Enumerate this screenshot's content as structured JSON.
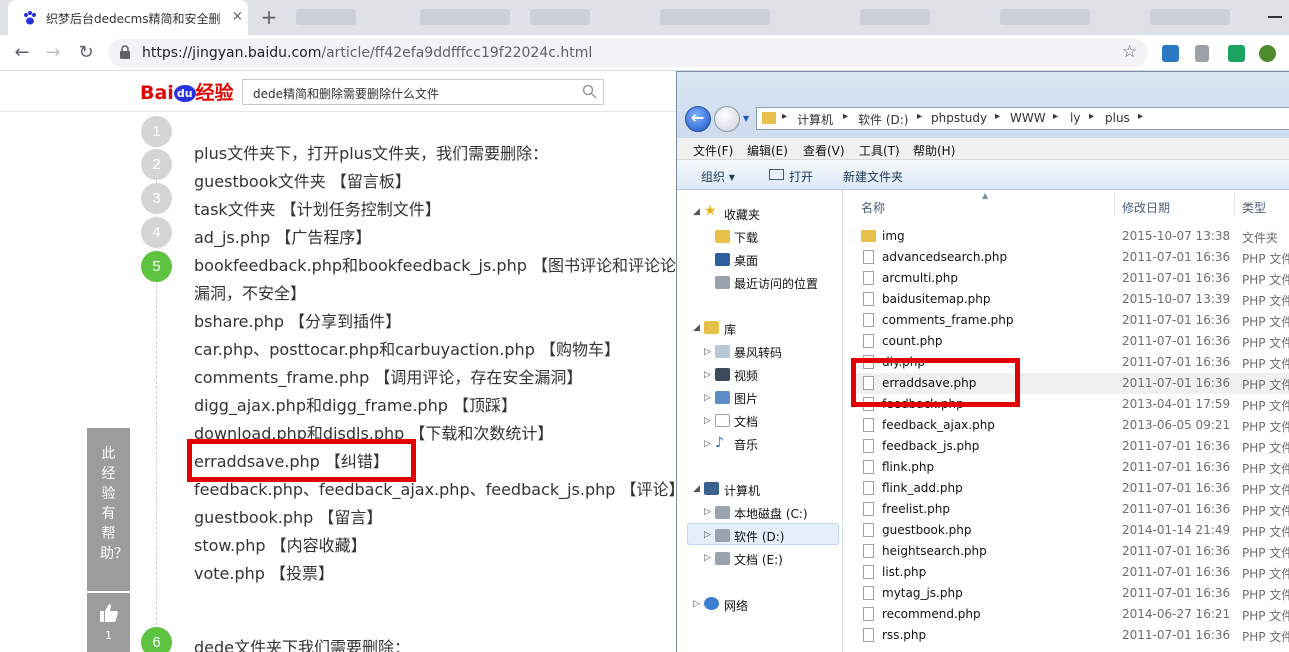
{
  "browser": {
    "tab_title": "织梦后台dedecms精简和安全删",
    "tab_close": "×",
    "new_tab": "+",
    "url_host": "https://jingyan.baidu.com",
    "url_path": "/article/ff42efa9ddfffcc19f22024c.html",
    "star": "☆"
  },
  "baidu": {
    "logo_bai": "Bai",
    "logo_du": "du",
    "logo_jy": "经验",
    "search_value": "dede精简和删除需要删除什么文件",
    "steps": [
      "1",
      "2",
      "3",
      "4",
      "5",
      "6"
    ],
    "lines": [
      "plus文件夹下，打开plus文件夹，我们需要删除：",
      "guestbook文件夹  【留言板】",
      "task文件夹        【计划任务控制文件】",
      "ad_js.php         【广告程序】",
      "bookfeedback.php和bookfeedback_js.php     【图书评论和评论论",
      "漏洞，不安全】",
      "bshare.php      【分享到插件】",
      "car.php、posttocar.php和carbuyaction.php     【购物车】",
      "comments_frame.php      【调用评论，存在安全漏洞】",
      "digg_ajax.php和digg_frame.php      【顶踩】",
      "download.php和disdls.php      【下载和次数统计】",
      "erraddsave.php     【纠错】",
      "feedback.php、feedback_ajax.php、feedback_js.php     【评论】",
      "guestbook.php      【留言】",
      "stow.php      【内容收藏】",
      "vote.php      【投票】",
      "dede文件夹下我们需要删除："
    ],
    "side_help": "此经验有帮助？",
    "like_count": "1"
  },
  "explorer": {
    "breadcrumbs": [
      "计算机",
      "软件 (D:)",
      "phpstudy",
      "WWW",
      "ly",
      "plus"
    ],
    "menu": [
      "文件(F)",
      "编辑(E)",
      "查看(V)",
      "工具(T)",
      "帮助(H)"
    ],
    "commands": {
      "organize": "组织 ▾",
      "open": "打开",
      "new_folder": "新建文件夹"
    },
    "tree": {
      "favorites": "收藏夹",
      "downloads": "下载",
      "desktop": "桌面",
      "recent": "最近访问的位置",
      "libraries": "库",
      "storm": "暴风转码",
      "videos": "视频",
      "pictures": "图片",
      "documents": "文档",
      "music": "音乐",
      "computer": "计算机",
      "drive_c": "本地磁盘 (C:)",
      "drive_d": "软件 (D:)",
      "drive_e": "文档 (E:)",
      "network": "网络"
    },
    "columns": {
      "name": "名称",
      "date": "修改日期",
      "type": "类型"
    },
    "files": [
      {
        "name": "img",
        "date": "2015-10-07 13:38",
        "type": "文件夹"
      },
      {
        "name": "advancedsearch.php",
        "date": "2011-07-01 16:36",
        "type": "PHP 文件"
      },
      {
        "name": "arcmulti.php",
        "date": "2011-07-01 16:36",
        "type": "PHP 文件"
      },
      {
        "name": "baidusitemap.php",
        "date": "2015-10-07 13:39",
        "type": "PHP 文件"
      },
      {
        "name": "comments_frame.php",
        "date": "2011-07-01 16:36",
        "type": "PHP 文件"
      },
      {
        "name": "count.php",
        "date": "2011-07-01 16:36",
        "type": "PHP 文件"
      },
      {
        "name": "diy.php",
        "date": "2011-07-01 16:36",
        "type": "PHP 文件"
      },
      {
        "name": "erraddsave.php",
        "date": "2011-07-01 16:36",
        "type": "PHP 文件"
      },
      {
        "name": "feedback.php",
        "date": "2013-04-01 17:59",
        "type": "PHP 文件"
      },
      {
        "name": "feedback_ajax.php",
        "date": "2013-06-05 09:21",
        "type": "PHP 文件"
      },
      {
        "name": "feedback_js.php",
        "date": "2011-07-01 16:36",
        "type": "PHP 文件"
      },
      {
        "name": "flink.php",
        "date": "2011-07-01 16:36",
        "type": "PHP 文件"
      },
      {
        "name": "flink_add.php",
        "date": "2011-07-01 16:36",
        "type": "PHP 文件"
      },
      {
        "name": "freelist.php",
        "date": "2011-07-01 16:36",
        "type": "PHP 文件"
      },
      {
        "name": "guestbook.php",
        "date": "2014-01-14 21:49",
        "type": "PHP 文件"
      },
      {
        "name": "heightsearch.php",
        "date": "2011-07-01 16:36",
        "type": "PHP 文件"
      },
      {
        "name": "list.php",
        "date": "2011-07-01 16:36",
        "type": "PHP 文件"
      },
      {
        "name": "mytag_js.php",
        "date": "2011-07-01 16:36",
        "type": "PHP 文件"
      },
      {
        "name": "recommend.php",
        "date": "2014-06-27 16:21",
        "type": "PHP 文件"
      },
      {
        "name": "rss.php",
        "date": "2011-07-01 16:36",
        "type": "PHP 文件"
      }
    ]
  },
  "colors": {
    "highlight_red": "#e40000",
    "step_green": "#5ec341",
    "baidu_red": "#e10601",
    "baidu_blue": "#2932e1"
  }
}
